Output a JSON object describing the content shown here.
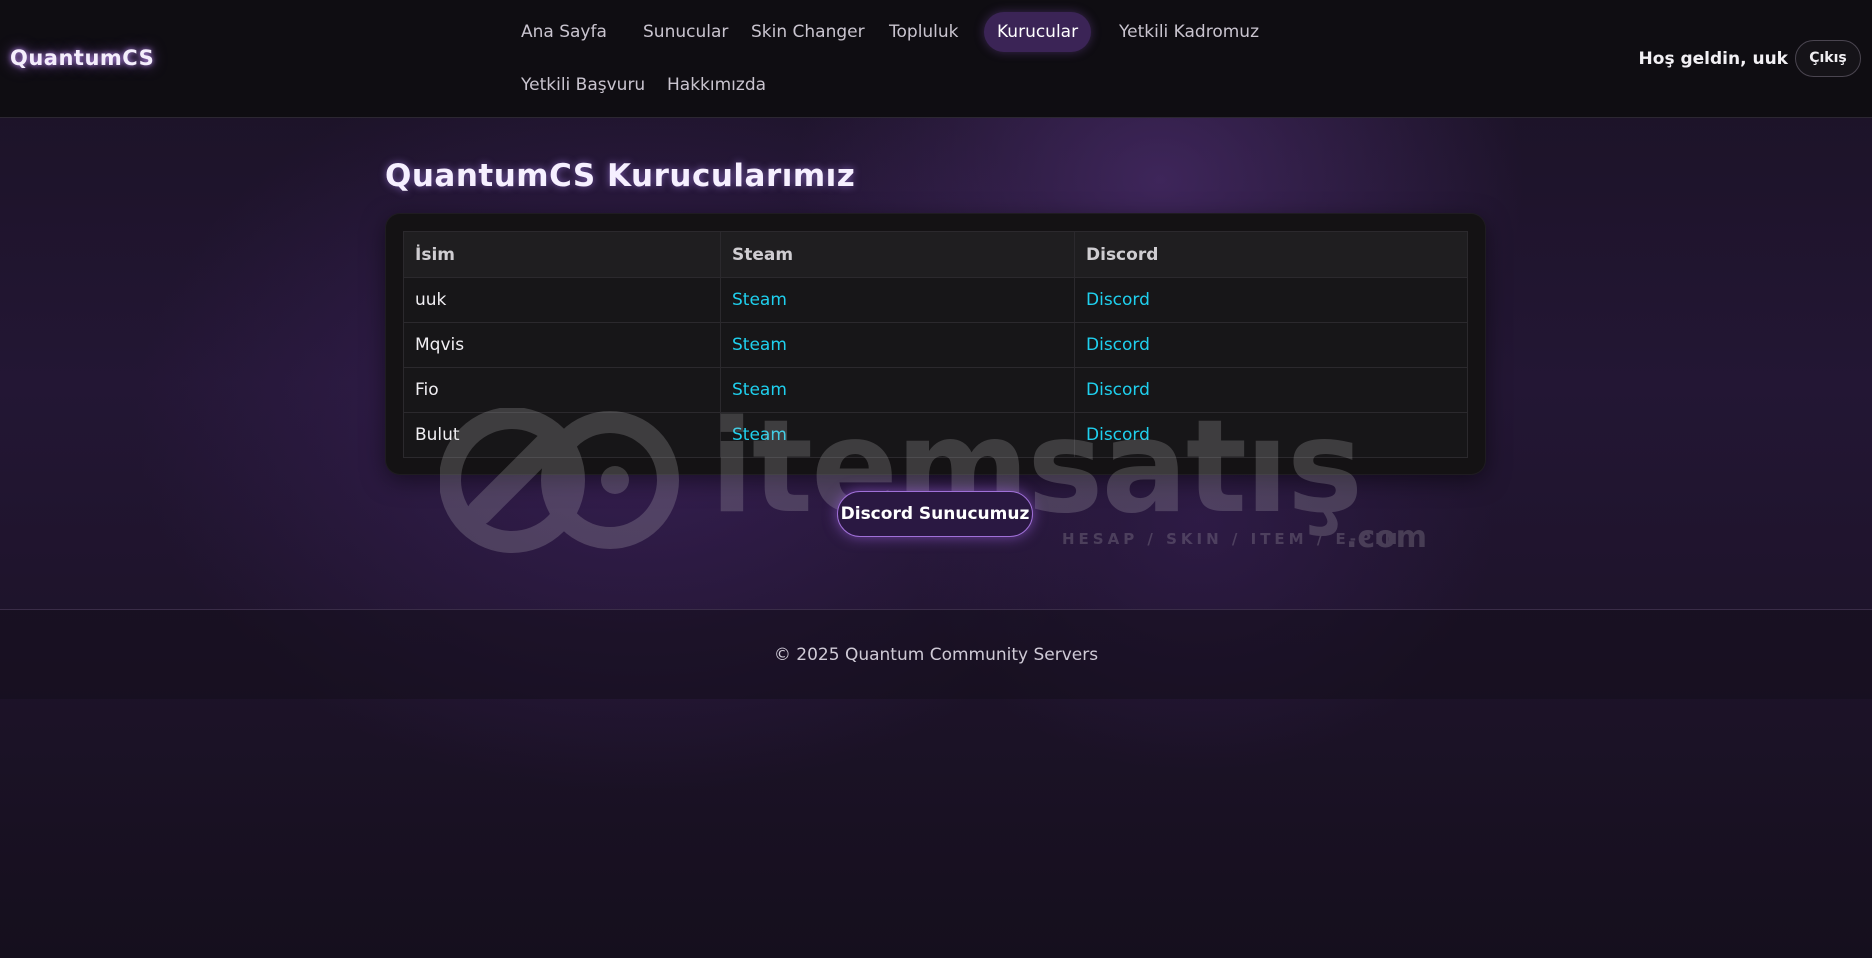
{
  "header": {
    "logo": "QuantumCS",
    "nav": [
      {
        "label": "Ana Sayfa",
        "active": false
      },
      {
        "label": "Sunucular",
        "active": false
      },
      {
        "label": "Skin Changer",
        "active": false
      },
      {
        "label": "Topluluk",
        "active": false
      },
      {
        "label": "Kurucular",
        "active": true
      },
      {
        "label": "Yetkili Kadromuz",
        "active": false
      },
      {
        "label": "Yetkili Başvuru",
        "active": false
      },
      {
        "label": "Hakkımızda",
        "active": false
      }
    ],
    "welcome": "Hoş geldin, uuk",
    "logout": "Çıkış"
  },
  "main": {
    "title": "QuantumCS Kurucularımız",
    "table": {
      "headers": [
        "İsim",
        "Steam",
        "Discord"
      ],
      "rows": [
        {
          "name": "uuk",
          "steam": "Steam",
          "discord": "Discord"
        },
        {
          "name": "Mqvis",
          "steam": "Steam",
          "discord": "Discord"
        },
        {
          "name": "Fio",
          "steam": "Steam",
          "discord": "Discord"
        },
        {
          "name": "Bulut",
          "steam": "Steam",
          "discord": "Discord"
        }
      ]
    },
    "discord_button": "Discord Sunucumuz"
  },
  "watermark": {
    "text": "itemsatış",
    "subtext": "HESAP / SKIN / ITEM / E-PIN",
    "suffix": ".com"
  },
  "footer": {
    "text": "© 2025 Quantum Community Servers"
  },
  "colors": {
    "accent": "#3b2456",
    "link": "#1fd0ee",
    "background": "#1d1329"
  }
}
